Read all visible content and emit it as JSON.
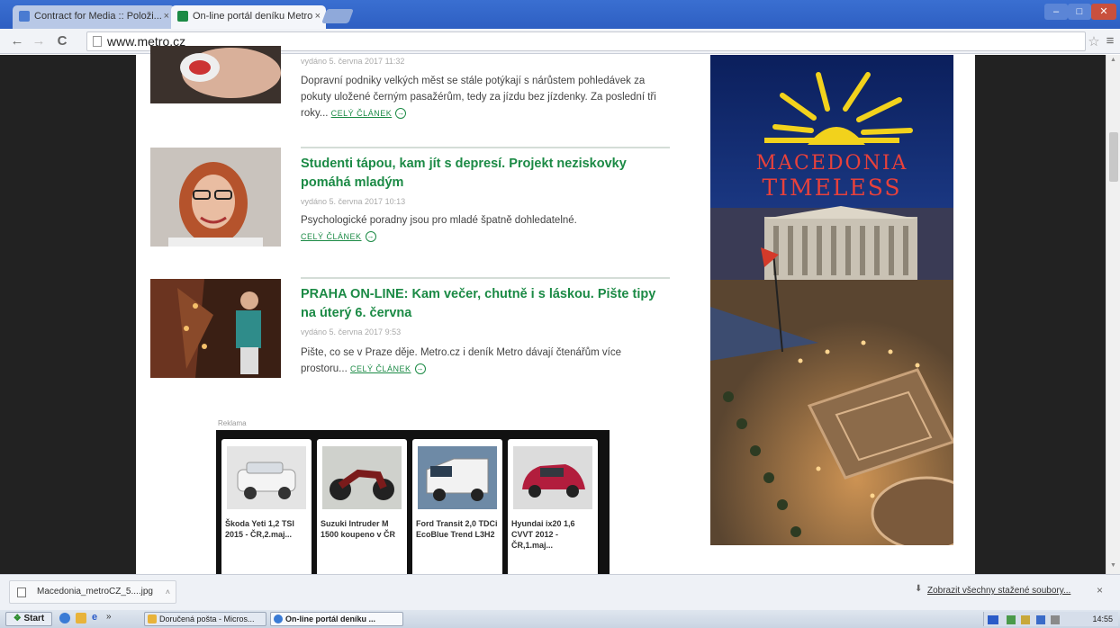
{
  "browser": {
    "tabs": [
      {
        "title": "Contract for Media :: Položi...",
        "active": false
      },
      {
        "title": "On-line portál deníku Metro",
        "active": true
      }
    ],
    "url": "www.metro.cz",
    "window_buttons": {
      "minimize": "–",
      "maximize": "□",
      "close": "✕"
    }
  },
  "articles": [
    {
      "meta": "vydáno 5. června 2017 11:32",
      "text": "Dopravní podniky velkých měst se stále potýkají s nárůstem pohledávek za pokuty uložené černým pasažérům, tedy za jízdu bez jízdenky. Za poslední tři roky...",
      "more": "CELÝ ČLÁNEK"
    },
    {
      "title": "Studenti tápou, kam jít s depresí. Projekt neziskovky pomáhá mladým",
      "meta": "vydáno 5. června 2017 10:13",
      "text": "Psychologické poradny jsou pro mladé špatně dohledatelné.",
      "more": "CELÝ ČLÁNEK"
    },
    {
      "title": "PRAHA ON-LINE: Kam večer, chutně i s láskou. Pište tipy na úterý 6. června",
      "meta": "vydáno 5. června 2017 9:53",
      "text": "Pište, co se v Praze děje. Metro.cz i deník Metro dávají čtenářům více prostoru...",
      "more": "CELÝ ČLÁNEK"
    }
  ],
  "ad_banner": {
    "label": "Reklama",
    "cards": [
      {
        "caption": "Škoda Yeti 1,2 TSI 2015 - ČR,2.maj..."
      },
      {
        "caption": "Suzuki Intruder M 1500 koupeno v ČR"
      },
      {
        "caption": "Ford Transit 2,0 TDCi EcoBlue Trend L3H2"
      },
      {
        "caption": "Hyundai ix20 1,6 CVVT 2012 - ČR,1.maj..."
      }
    ]
  },
  "side_ad": {
    "line1": "MACEDONIA",
    "line2": "TIMELESS"
  },
  "download_bar": {
    "file": "Macedonia_metroCZ_5....jpg",
    "show_all": "Zobrazit všechny stažené soubory...",
    "close": "×"
  },
  "taskbar": {
    "start": "Start",
    "tasks": [
      "Doručená pošta - Micros...",
      "On-line portál deníku ..."
    ],
    "clock": "14:55"
  },
  "colors": {
    "accent_green": "#1b8a45",
    "titlebar_blue": "#3a6fd1"
  }
}
